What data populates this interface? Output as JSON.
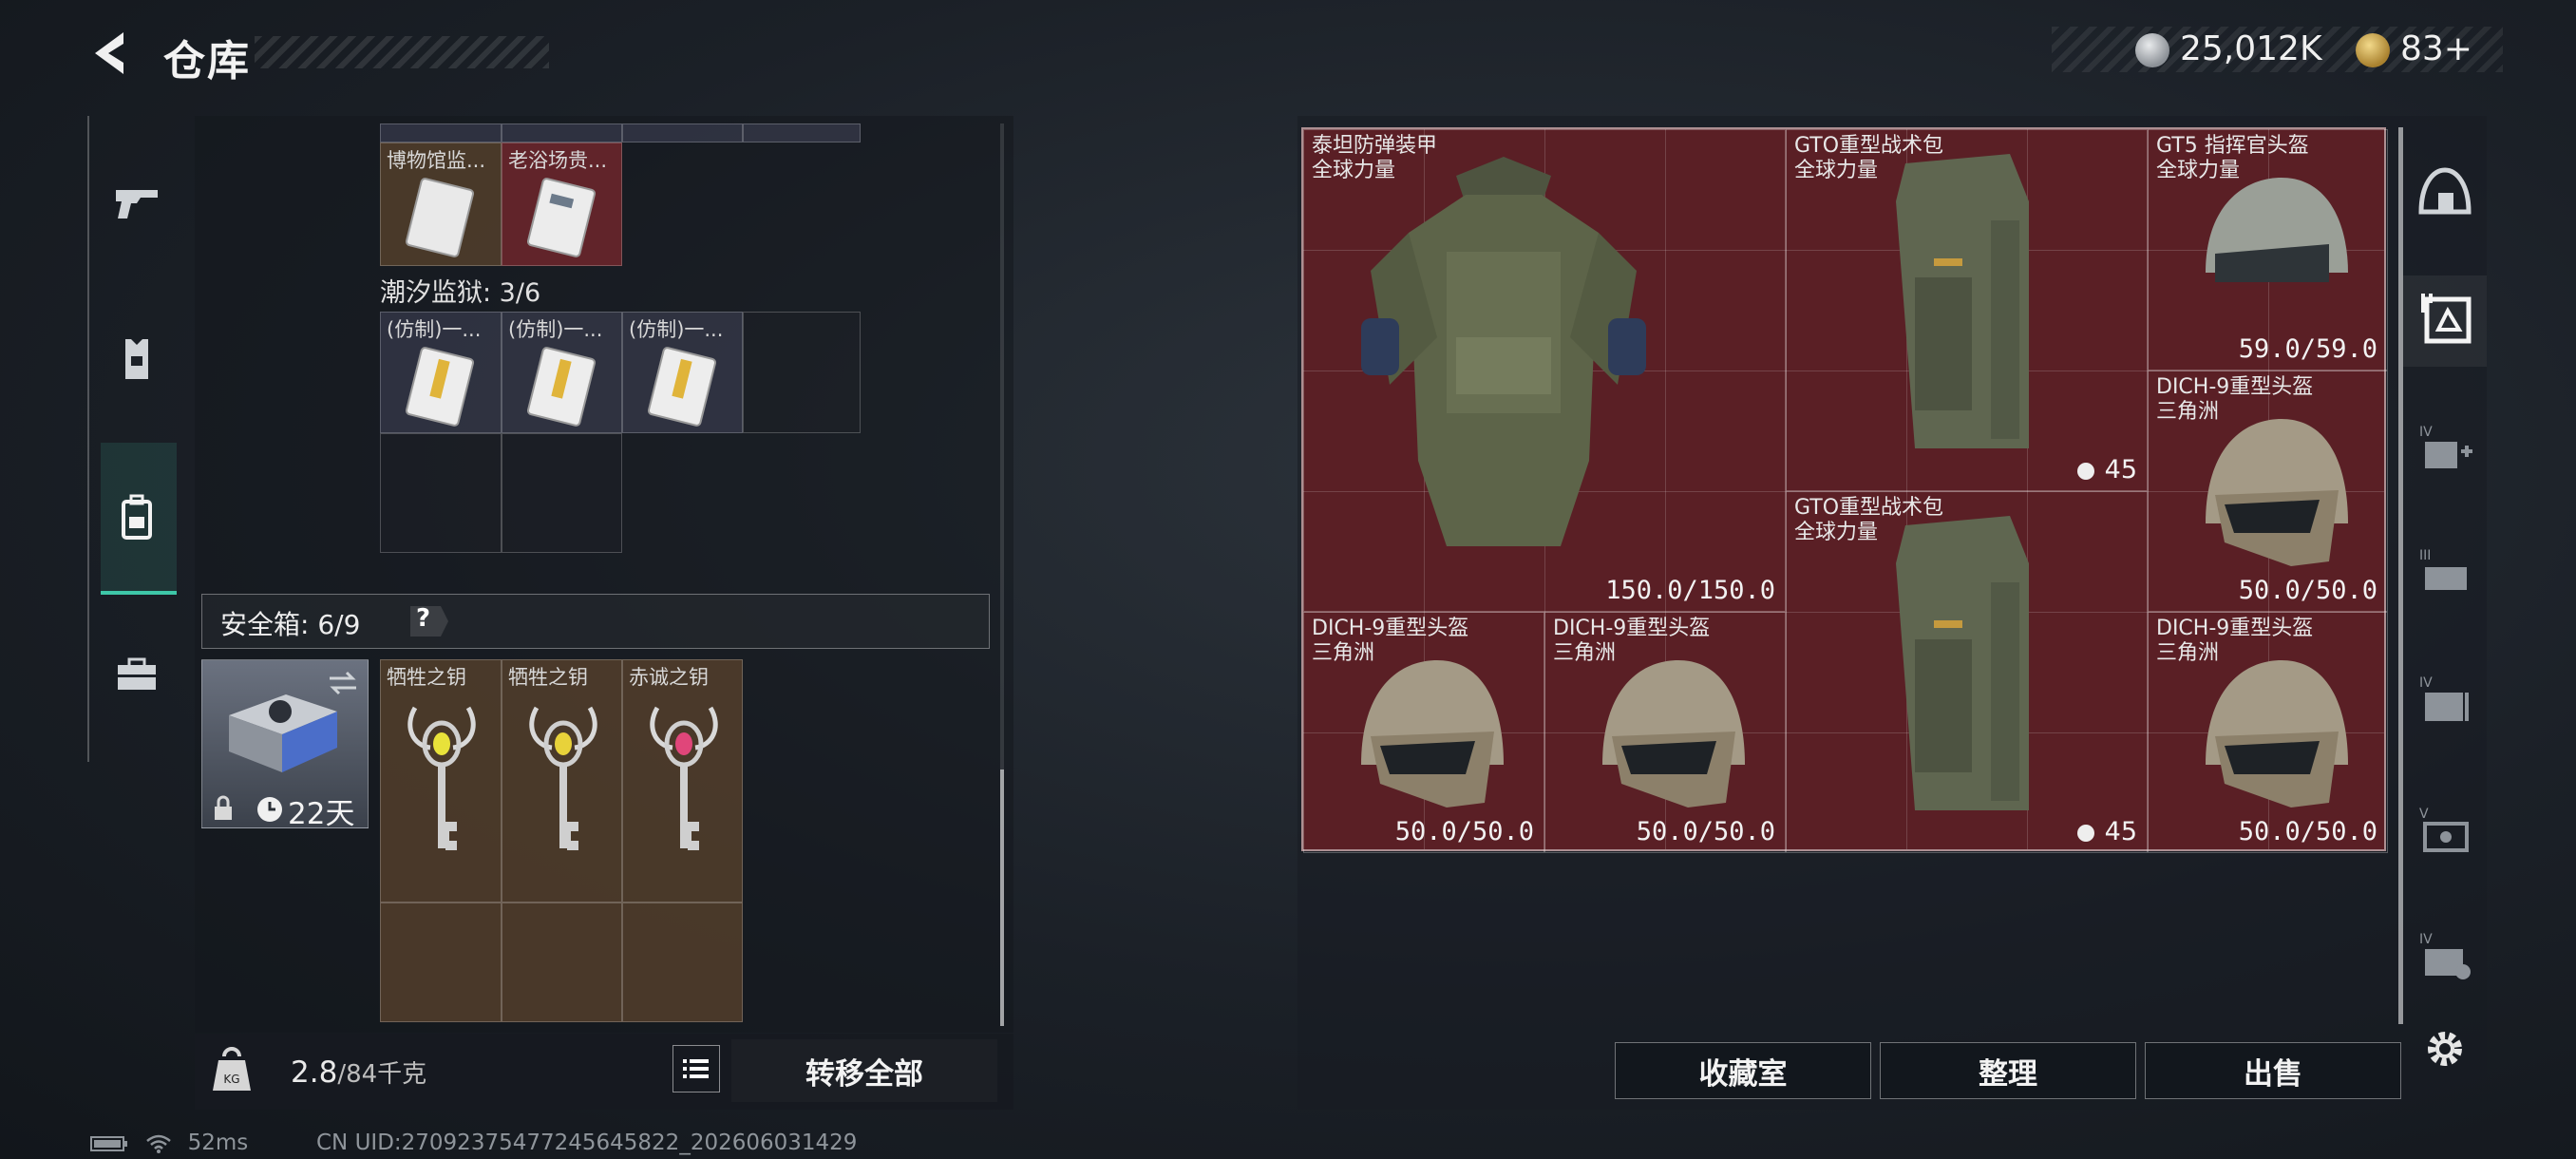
{
  "header": {
    "title": "仓库",
    "currency_main": "25,012K",
    "currency_premium": "83+"
  },
  "left_panel": {
    "top_items": [
      "博物馆监...",
      "老浴场贵..."
    ],
    "tide_prison": {
      "label": "潮汐监狱: 3/6",
      "items": [
        "(仿制)一...",
        "(仿制)一...",
        "(仿制)一..."
      ]
    },
    "safebox": {
      "label": "安全箱: 6/9",
      "help": "?",
      "duration": "22天",
      "keys": [
        "牺牲之钥",
        "牺牲之钥",
        "赤诚之钥"
      ]
    },
    "weight": {
      "current": "2.8",
      "max": "/84千克"
    },
    "transfer_all": "转移全部"
  },
  "stash": {
    "items": [
      {
        "name": "泰坦防弹装甲",
        "sub": "全球力量",
        "dura": "150.0/150.0"
      },
      {
        "name": "GTO重型战术包",
        "sub": "全球力量",
        "count": "45"
      },
      {
        "name": "GT5 指挥官头盔",
        "sub": "全球力量",
        "dura": "59.0/59.0"
      },
      {
        "name": "DICH-9重型头盔",
        "sub": "三角洲",
        "dura": "50.0/50.0"
      },
      {
        "name": "GTO重型战术包",
        "sub": "全球力量",
        "count": "45"
      },
      {
        "name": "DICH-9重型头盔",
        "sub": "三角洲",
        "dura": "50.0/50.0"
      },
      {
        "name": "DICH-9重型头盔",
        "sub": "三角洲",
        "dura": "50.0/50.0"
      },
      {
        "name": "DICH-9重型头盔",
        "sub": "三角洲",
        "dura": "50.0/50.0"
      }
    ]
  },
  "buttons": {
    "collection": "收藏室",
    "organize": "整理",
    "sell": "出售"
  },
  "status": {
    "ping": "52ms",
    "uid": "CN UID:27092375477245645822_202606031429"
  },
  "icons": {
    "rail": [
      "pistol-icon",
      "vest-icon",
      "backpack-icon",
      "briefcase-icon"
    ],
    "right_rail": [
      "helmet-icon",
      "stash-icon",
      "stash-iv-add-icon",
      "stash-iii-icon",
      "stash-iv-icon",
      "stash-v-icon",
      "stash-iv-b-icon",
      "settings-gear-icon"
    ]
  },
  "colors": {
    "accent": "#3ec7a8",
    "stash_bg": "#5a1f25"
  }
}
